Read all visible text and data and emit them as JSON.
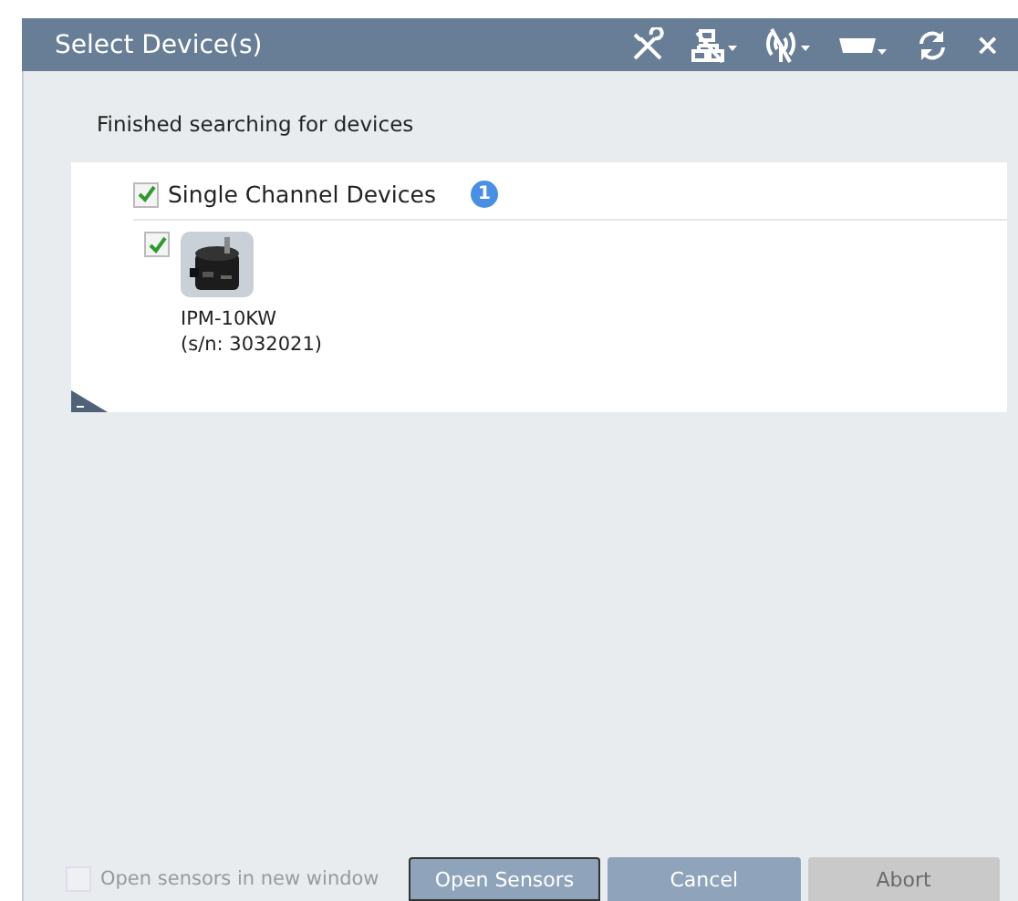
{
  "window": {
    "title": "Select Device(s)",
    "close": "×"
  },
  "status": "Finished searching for devices",
  "group": {
    "label": "Single Channel Devices",
    "checked": true,
    "count": "1",
    "devices": [
      {
        "name": "IPM-10KW",
        "serial": "(s/n: 3032021)",
        "checked": true
      }
    ]
  },
  "option": {
    "label": "Open sensors in new window",
    "checked": false,
    "disabled": true
  },
  "buttons": [
    {
      "label": "Open Sensors",
      "default": true,
      "disabled": false
    },
    {
      "label": "Cancel",
      "default": false,
      "disabled": false
    },
    {
      "label": "Abort",
      "default": false,
      "disabled": true
    }
  ]
}
